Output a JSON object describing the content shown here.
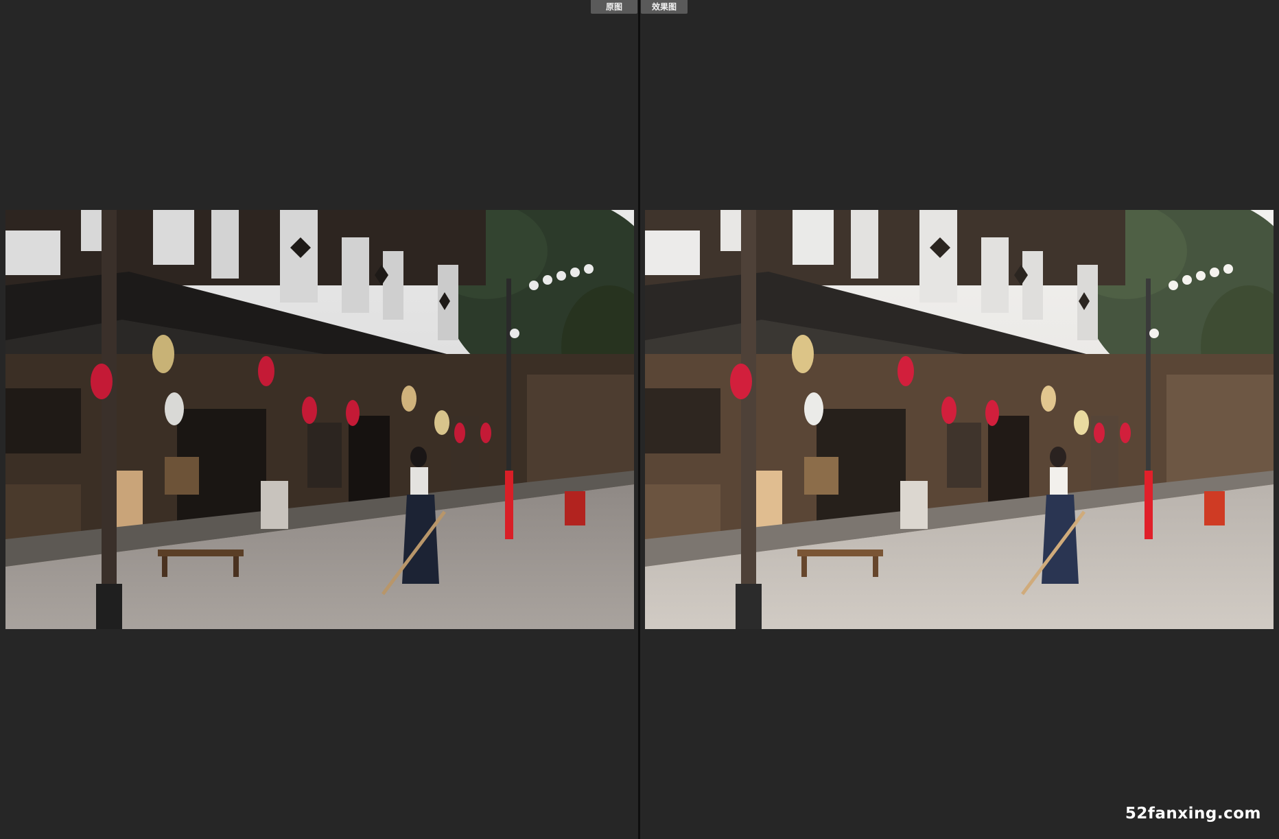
{
  "tabs": {
    "original_label": "原图",
    "effect_label": "效果图"
  },
  "images": {
    "original_alt": "",
    "effect_alt": ""
  },
  "watermark": "52fanxing.com",
  "colors": {
    "background": "#262626",
    "tab_background": "#5a5a5a",
    "lantern_red": "#d21f3c",
    "pole_red": "#e0202a"
  },
  "icons": {
    "compare_divider": "vertical-divider"
  }
}
